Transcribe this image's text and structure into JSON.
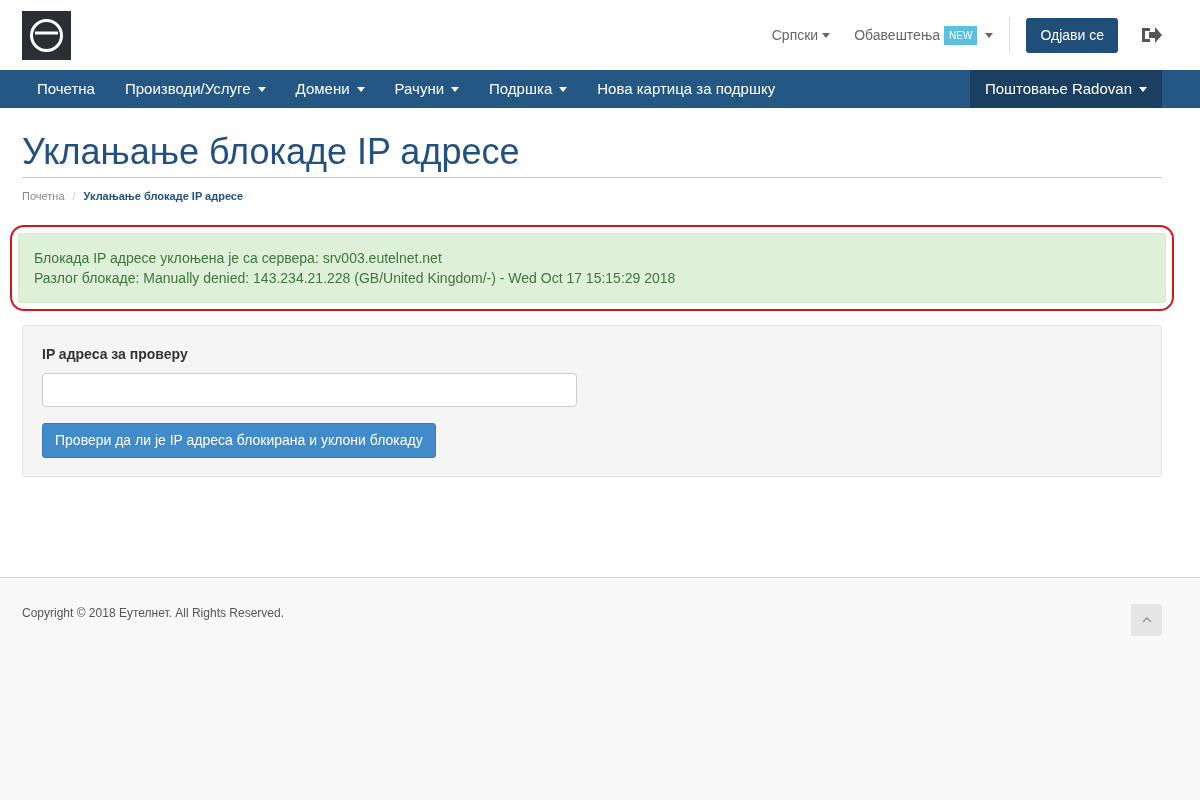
{
  "header": {
    "language": "Српски",
    "notifications": {
      "label": "Обавештења",
      "badge": "NEW"
    },
    "logout_button": "Одјави се"
  },
  "nav": {
    "items": [
      {
        "label": "Почетна",
        "kind": "link"
      },
      {
        "label": "Производи/Услуге",
        "kind": "dropdown"
      },
      {
        "label": "Домени",
        "kind": "dropdown"
      },
      {
        "label": "Рачуни",
        "kind": "dropdown"
      },
      {
        "label": "Подршка",
        "kind": "dropdown"
      },
      {
        "label": "Нова картица за подршку",
        "kind": "link"
      }
    ],
    "user_menu": {
      "greeting": "Поштовање",
      "name": "Radovan"
    }
  },
  "page_title": "Уклањање блокаде IP адресе",
  "breadcrumb_separator": "/",
  "breadcrumb": [
    {
      "label": "Почетна",
      "selected": false
    },
    {
      "label": "Уклањање блокаде IP адресе",
      "selected": true
    }
  ],
  "alert": {
    "lines": [
      "Блокада IP адресе уклоњена је са сервера: srv003.eutelnet.net",
      "Разлог блокаде: Manually denied: 143.234.21.228 (GB/United Kingdom/-) - Wed Oct 17 15:15:29 2018"
    ]
  },
  "form": {
    "label": "IP адреса за проверу",
    "button": "Провери да ли је IP адреса блокирана и уклони блокаду"
  },
  "footer": {
    "copyright": "Copyright © 2018 Еутелнет. All Rights Reserved."
  }
}
